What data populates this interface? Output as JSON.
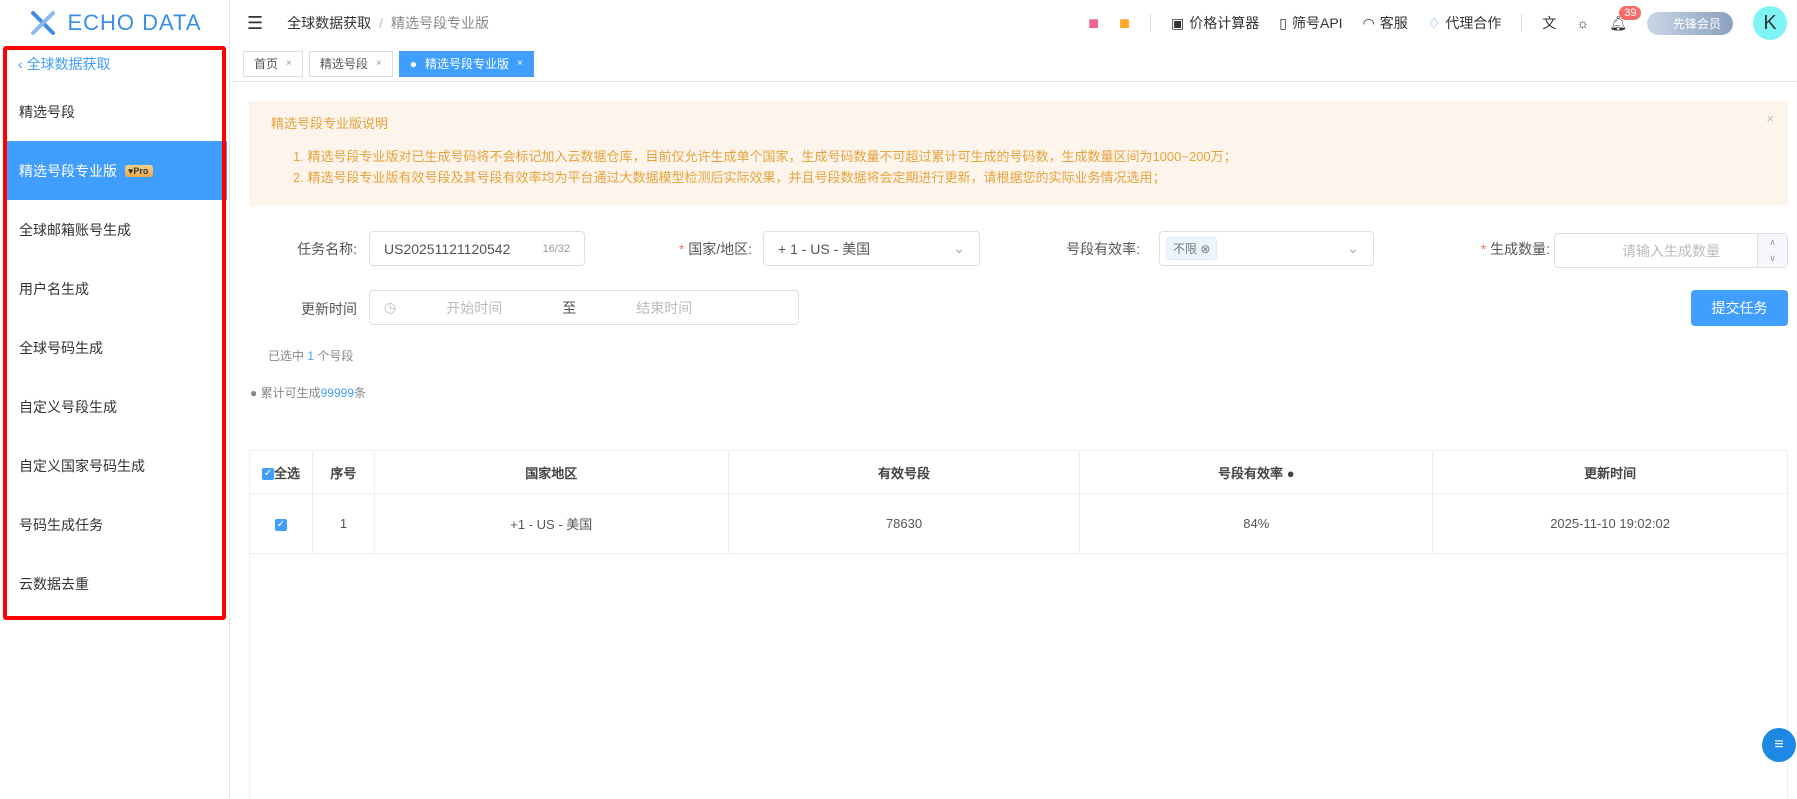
{
  "brand": "ECHO DATA",
  "sidebar": {
    "back": "全球数据获取",
    "pro_badge": "Pro",
    "items": [
      {
        "label": "精选号段"
      },
      {
        "label": "精选号段专业版"
      },
      {
        "label": "全球邮箱账号生成"
      },
      {
        "label": "用户名生成"
      },
      {
        "label": "全球号码生成"
      },
      {
        "label": "自定义号段生成"
      },
      {
        "label": "自定义国家号码生成"
      },
      {
        "label": "号码生成任务"
      },
      {
        "label": "云数据去重"
      }
    ]
  },
  "header": {
    "breadcrumb": [
      "全球数据获取",
      "精选号段专业版"
    ],
    "breadcrumb_sep": "/",
    "price_calc": "价格计算器",
    "api": "筛号API",
    "service": "客服",
    "agent": "代理合作",
    "notifications": "39",
    "vip": "先锋会员",
    "avatar": "K"
  },
  "tabs": [
    {
      "label": "首页"
    },
    {
      "label": "精选号段"
    },
    {
      "label": "精选号段专业版"
    }
  ],
  "notice": {
    "title": "精选号段专业版说明",
    "lines": [
      "1. 精选号段专业版对已生成号码将不会标记加入云数据仓库，目前仅允许生成单个国家，生成号码数量不可超过累计可生成的号码数，生成数量区间为1000~200万；",
      "2. 精选号段专业版有效号段及其号段有效率均为平台通过大数据模型检测后实际效果，并且号段数据将会定期进行更新，请根据您的实际业务情况选用；"
    ]
  },
  "form": {
    "task_label": "任务名称:",
    "task_value": "US20251121120542",
    "task_count": "16/32",
    "country_label": "国家/地区:",
    "country_value": "+ 1 - US - 美国",
    "rate_label": "号段有效率:",
    "rate_tag": "不限",
    "qty_label": "生成数量:",
    "qty_placeholder": "请输入生成数量",
    "time_label": "更新时间",
    "start_placeholder": "开始时间",
    "to": "至",
    "end_placeholder": "结束时间",
    "submit": "提交任务",
    "required_mark": "*"
  },
  "selected": {
    "prefix": "已选中",
    "count": "1",
    "suffix": "个号段"
  },
  "total": {
    "prefix": "累计可生成",
    "count": "99999",
    "suffix": "条"
  },
  "table": {
    "select_all": "全选",
    "headers": [
      "序号",
      "国家地区",
      "有效号段",
      "号段有效率",
      "更新时间"
    ],
    "rows": [
      {
        "index": "1",
        "country": "+1 - US - 美国",
        "segments": "78630",
        "rate": "84%",
        "updated": "2025-11-10 19:02:02"
      }
    ]
  }
}
